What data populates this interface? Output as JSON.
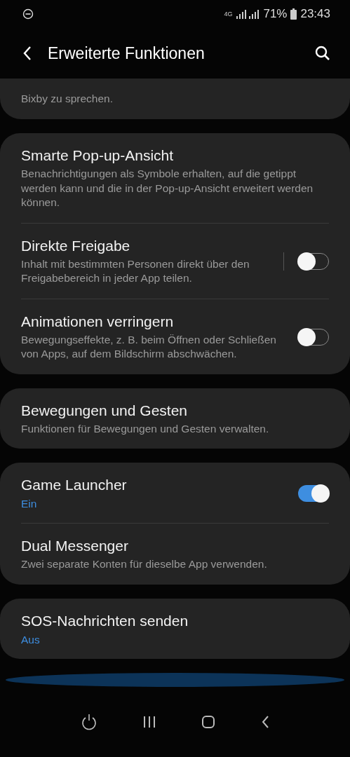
{
  "status_bar": {
    "network": "4G",
    "battery": "71%",
    "time": "23:43"
  },
  "header": {
    "title": "Erweiterte Funktionen"
  },
  "partial_card": {
    "description": "Bixby zu sprechen."
  },
  "groups": [
    {
      "items": [
        {
          "kind": "plain",
          "title": "Smarte Pop-up-Ansicht",
          "description": "Benachrichtigungen als Symbole erhalten, auf die getippt werden kann und die in der Pop-up-Ansicht erweitert werden können."
        },
        {
          "kind": "toggle",
          "title": "Direkte Freigabe",
          "description": "Inhalt mit bestimmten Personen direkt über den Freigabebereich in jeder App teilen.",
          "on": false,
          "separator": true
        },
        {
          "kind": "toggle",
          "title": "Animationen verringern",
          "description": "Bewegungseffekte, z. B. beim Öffnen oder Schließen von Apps, auf dem Bildschirm abschwächen.",
          "on": false,
          "separator": false
        }
      ]
    },
    {
      "items": [
        {
          "kind": "plain",
          "title": "Bewegungen und Gesten",
          "description": "Funktionen für Bewegungen und Gesten verwalten."
        }
      ]
    },
    {
      "items": [
        {
          "kind": "toggle",
          "title": "Game Launcher",
          "status": "Ein",
          "on": true,
          "separator": false
        },
        {
          "kind": "plain",
          "title": "Dual Messenger",
          "description": "Zwei separate Konten für dieselbe App verwenden."
        }
      ]
    },
    {
      "items": [
        {
          "kind": "plain",
          "title": "SOS-Nachrichten senden",
          "status": "Aus"
        }
      ]
    }
  ]
}
